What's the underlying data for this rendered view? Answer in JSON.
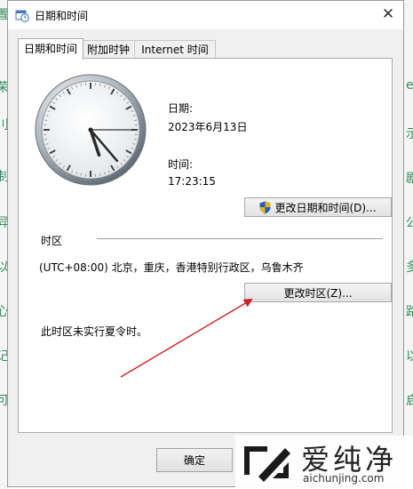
{
  "window": {
    "title": "日期和时间",
    "close_symbol": "✕"
  },
  "tabs": [
    {
      "label": "日期和时间",
      "active": true
    },
    {
      "label": "附加时钟",
      "active": false
    },
    {
      "label": "Internet 时间",
      "active": false
    }
  ],
  "clock": {
    "hour": 5,
    "minute": 23,
    "second": 15
  },
  "date": {
    "label": "日期:",
    "value": "2023年6月13日"
  },
  "time": {
    "label": "时间:",
    "value": "17:23:15"
  },
  "change_datetime_button": "更改日期和时间(D)...",
  "timezone": {
    "section_label": "时区",
    "value": "(UTC+08:00) 北京，重庆，香港特别行政区，乌鲁木齐",
    "change_button": "更改时区(Z)...",
    "dst_note": "此时区未实行夏令时。"
  },
  "footer": {
    "ok_button": "确定"
  },
  "watermark": {
    "title": "爱纯净",
    "url": "aichunjing.com"
  },
  "background_glyphs": {
    "left": [
      "置",
      "荣",
      "刂",
      "制",
      "异",
      "以",
      "心",
      "记",
      "可"
    ],
    "right": [
      "e",
      "示",
      "剧",
      "公",
      "多",
      "路",
      "以",
      "启"
    ]
  },
  "colors": {
    "annotation_arrow": "#cc2222",
    "shield_blue": "#1f5fbf",
    "shield_gold": "#e8b21a"
  }
}
